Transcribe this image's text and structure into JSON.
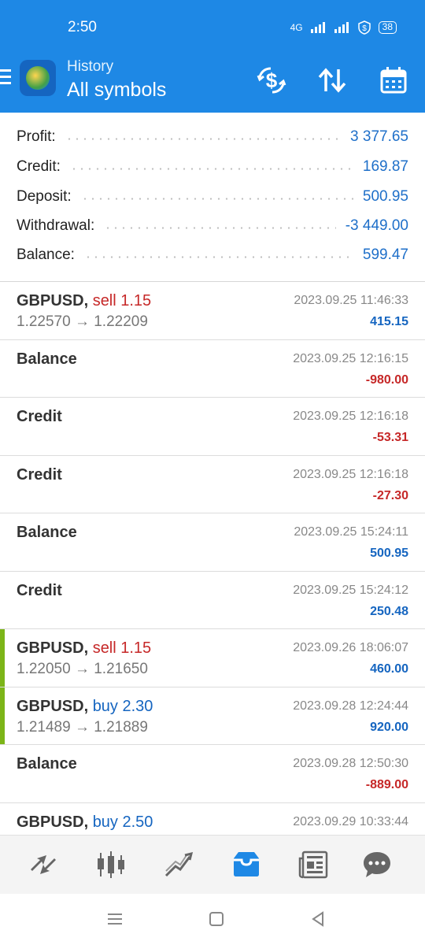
{
  "status": {
    "time": "2:50",
    "network": "4G",
    "battery": "38"
  },
  "header": {
    "subtitle": "History",
    "title": "All symbols",
    "icons": [
      "menu-icon",
      "currency-exchange-icon",
      "sort-icon",
      "calendar-icon"
    ]
  },
  "summary": {
    "profit_label": "Profit:",
    "profit_value": "3 377.65",
    "credit_label": "Credit:",
    "credit_value": "169.87",
    "deposit_label": "Deposit:",
    "deposit_value": "500.95",
    "withdrawal_label": "Withdrawal:",
    "withdrawal_value": "-3 449.00",
    "balance_label": "Balance:",
    "balance_value": "599.47"
  },
  "deals": [
    {
      "symbol": "GBPUSD,",
      "action": "sell 1.15",
      "prices": "1.22570 → 1.22209",
      "datetime": "2023.09.25 11:46:33",
      "amount": "415.15"
    },
    {
      "symbol": "Balance",
      "action": "",
      "prices": "",
      "datetime": "2023.09.25 12:16:15",
      "amount": "-980.00"
    },
    {
      "symbol": "Credit",
      "action": "",
      "prices": "",
      "datetime": "2023.09.25 12:16:18",
      "amount": "-53.31"
    },
    {
      "symbol": "Credit",
      "action": "",
      "prices": "",
      "datetime": "2023.09.25 12:16:18",
      "amount": "-27.30"
    },
    {
      "symbol": "Balance",
      "action": "",
      "prices": "",
      "datetime": "2023.09.25 15:24:11",
      "amount": "500.95"
    },
    {
      "symbol": "Credit",
      "action": "",
      "prices": "",
      "datetime": "2023.09.25 15:24:12",
      "amount": "250.48"
    },
    {
      "symbol": "GBPUSD,",
      "action": "sell 1.15",
      "prices": "1.22050 → 1.21650",
      "datetime": "2023.09.26 18:06:07",
      "amount": "460.00"
    },
    {
      "symbol": "GBPUSD,",
      "action": "buy 2.30",
      "prices": "1.21489 → 1.21889",
      "datetime": "2023.09.28 12:24:44",
      "amount": "920.00"
    },
    {
      "symbol": "Balance",
      "action": "",
      "prices": "",
      "datetime": "2023.09.28 12:50:30",
      "amount": "-889.00"
    },
    {
      "symbol": "GBPUSD,",
      "action": "buy 2.50",
      "prices": "",
      "datetime": "2023.09.29 10:33:44",
      "amount": ""
    }
  ],
  "bottom_tabs": [
    "quotes-icon",
    "chart-icon",
    "trade-icon",
    "history-icon",
    "news-icon",
    "messages-icon"
  ],
  "colors": {
    "header": "#1e88e5",
    "positive": "#1565c0",
    "negative": "#c62828",
    "accent": "#7cb518"
  }
}
